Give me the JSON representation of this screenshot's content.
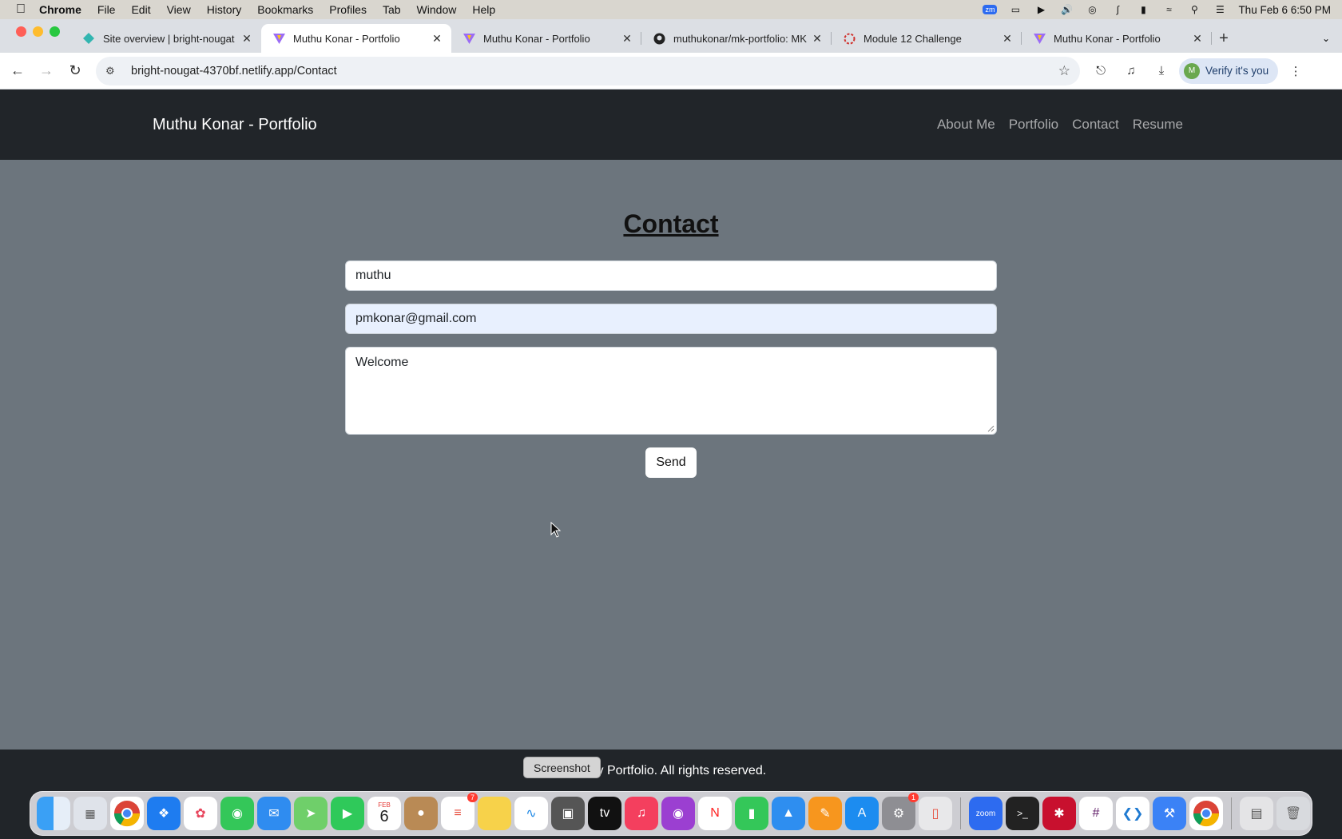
{
  "menubar": {
    "items": [
      "Chrome",
      "File",
      "Edit",
      "View",
      "History",
      "Bookmarks",
      "Profiles",
      "Tab",
      "Window",
      "Help"
    ],
    "zm_label": "zm",
    "clock": "Thu Feb 6  6:50 PM"
  },
  "tabs": [
    {
      "title": "Site overview | bright-nougat",
      "favicon": "netlify-icon"
    },
    {
      "title": "Muthu Konar - Portfolio",
      "favicon": "vite-icon",
      "active": true
    },
    {
      "title": "Muthu Konar - Portfolio",
      "favicon": "vite-icon"
    },
    {
      "title": "muthukonar/mk-portfolio: MK",
      "favicon": "github-icon"
    },
    {
      "title": "Module 12 Challenge",
      "favicon": "module-icon"
    },
    {
      "title": "Muthu Konar - Portfolio",
      "favicon": "vite-icon"
    }
  ],
  "toolbar": {
    "url": "bright-nougat-4370bf.netlify.app/Contact",
    "verify_label": "Verify it's you",
    "avatar_initial": "M"
  },
  "site": {
    "brand": "Muthu Konar - Portfolio",
    "nav": [
      "About Me",
      "Portfolio",
      "Contact",
      "Resume"
    ]
  },
  "contact": {
    "heading": "Contact",
    "name_value": "muthu",
    "email_value": "pmkonar@gmail.com",
    "message_value": "Welcome",
    "send_label": "Send"
  },
  "footer": {
    "text": "5 My Portfolio. All rights reserved."
  },
  "dock": {
    "tooltip": "Screenshot",
    "calendar_month": "FEB",
    "calendar_day": "6",
    "reminders_badge": "7",
    "settings_badge": "1",
    "zoom_label": "zoom"
  }
}
